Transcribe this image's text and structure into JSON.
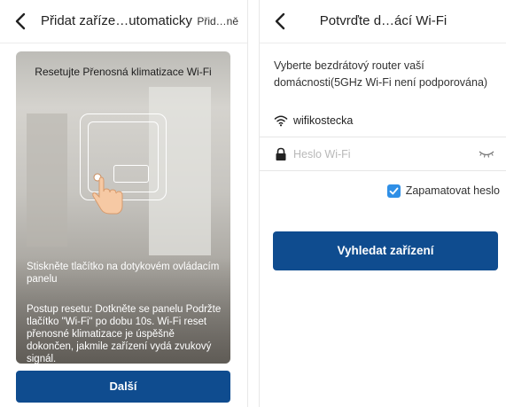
{
  "left": {
    "nav_title": "Přidat zaříze…utomaticky",
    "nav_right": "Přid…ně",
    "card_title": "Resetujte Přenosná klimatizace Wi-Fi",
    "instruction": "Stiskněte tlačítko na dotykovém ovládacím panelu",
    "reset_procedure": "Postup resetu: Dotkněte se panelu Podržte tlačítko \"Wi-Fi\" po dobu 10s. Wi-Fi reset přenosné klimatizace je úspěšně dokončen, jakmile zařízení vydá zvukový signál.",
    "next_button": "Další"
  },
  "right": {
    "nav_title": "Potvrďte d…ácí Wi-Fi",
    "description": "Vyberte bezdrátový router vaší domácnosti(5GHz Wi-Fi není podporována)",
    "ssid": "wifikostecka",
    "password_placeholder": "Heslo Wi-Fi",
    "password_value": "",
    "remember_label": "Zapamatovat heslo",
    "remember_checked": true,
    "search_button": "Vyhledat zařízení"
  },
  "icons": {
    "back": "chevron-left-icon",
    "wifi": "wifi-icon",
    "lock": "lock-icon",
    "eye": "eye-closed-icon",
    "check": "checkbox-checked-icon",
    "hand": "tap-hand-icon"
  },
  "colors": {
    "primary_button": "#0f4c8f",
    "checkbox": "#2f8fe6"
  }
}
